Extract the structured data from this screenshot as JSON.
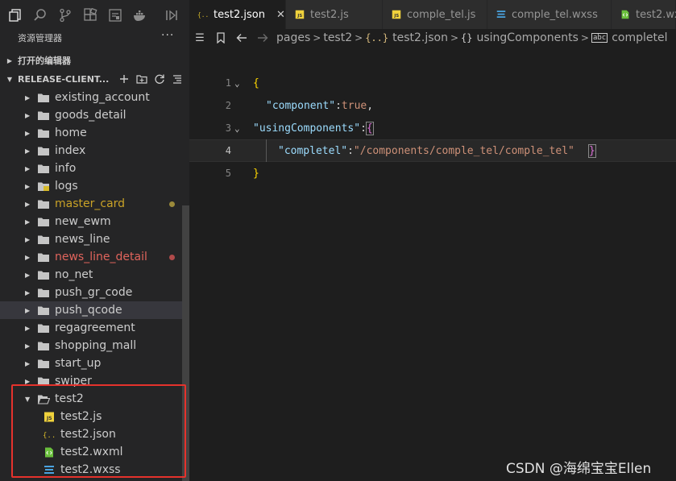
{
  "explorer": {
    "title": "资源管理器",
    "more": "···",
    "open_editors": "打开的编辑器",
    "workspace": "RELEASE-CLIENT..."
  },
  "tree": [
    {
      "label": "existing_account",
      "kind": "folder",
      "color": "#cccccc"
    },
    {
      "label": "goods_detail",
      "kind": "folder",
      "color": "#cccccc"
    },
    {
      "label": "home",
      "kind": "folder",
      "color": "#cccccc"
    },
    {
      "label": "index",
      "kind": "folder",
      "color": "#cccccc"
    },
    {
      "label": "info",
      "kind": "folder",
      "color": "#cccccc"
    },
    {
      "label": "logs",
      "kind": "folder-logs",
      "color": "#cccccc"
    },
    {
      "label": "master_card",
      "kind": "folder",
      "color": "#c9a227",
      "dot": "#9b8a3a"
    },
    {
      "label": "new_ewm",
      "kind": "folder",
      "color": "#cccccc"
    },
    {
      "label": "news_line",
      "kind": "folder",
      "color": "#cccccc"
    },
    {
      "label": "news_line_detail",
      "kind": "folder",
      "color": "#e0645c",
      "dot": "#b04a4a"
    },
    {
      "label": "no_net",
      "kind": "folder",
      "color": "#cccccc"
    },
    {
      "label": "push_gr_code",
      "kind": "folder",
      "color": "#cccccc"
    },
    {
      "label": "push_qcode",
      "kind": "folder",
      "color": "#cccccc",
      "selected": true
    },
    {
      "label": "regagreement",
      "kind": "folder",
      "color": "#cccccc"
    },
    {
      "label": "shopping_mall",
      "kind": "folder",
      "color": "#cccccc"
    },
    {
      "label": "start_up",
      "kind": "folder",
      "color": "#cccccc"
    },
    {
      "label": "swiper",
      "kind": "folder",
      "color": "#cccccc"
    },
    {
      "label": "test2",
      "kind": "folder-open",
      "color": "#cccccc"
    },
    {
      "label": "test2.js",
      "kind": "js",
      "color": "#cccccc"
    },
    {
      "label": "test2.json",
      "kind": "json",
      "color": "#cccccc"
    },
    {
      "label": "test2.wxml",
      "kind": "wxml",
      "color": "#cccccc"
    },
    {
      "label": "test2.wxss",
      "kind": "wxss",
      "color": "#cccccc"
    }
  ],
  "tabs": [
    {
      "label": "test2.json",
      "icon": "json",
      "active": true,
      "close": "✕"
    },
    {
      "label": "test2.js",
      "icon": "js"
    },
    {
      "label": "comple_tel.js",
      "icon": "js"
    },
    {
      "label": "comple_tel.wxss",
      "icon": "wxss"
    },
    {
      "label": "test2.wx",
      "icon": "wxml"
    }
  ],
  "breadcrumbs": {
    "items": [
      "pages",
      "test2",
      "test2.json",
      "usingComponents",
      "completel"
    ],
    "json_icon": "{..}",
    "object_icon": "{}",
    "string_icon": "abc"
  },
  "code": {
    "line_numbers": [
      "1",
      "2",
      "3",
      "4",
      "5"
    ],
    "lines": [
      {
        "open": "{"
      },
      {
        "key": "\"component\"",
        "colon": ":",
        "value": "true",
        "comma": ","
      },
      {
        "key": "\"usingComponents\"",
        "colon": ": ",
        "open": "{"
      },
      {
        "key": "\"completel\"",
        "colon": ": ",
        "value": "\"/components/comple_tel/comple_tel\"",
        "close": "}"
      },
      {
        "close": "}"
      }
    ]
  },
  "watermark": "CSDN @海绵宝宝Ellen"
}
